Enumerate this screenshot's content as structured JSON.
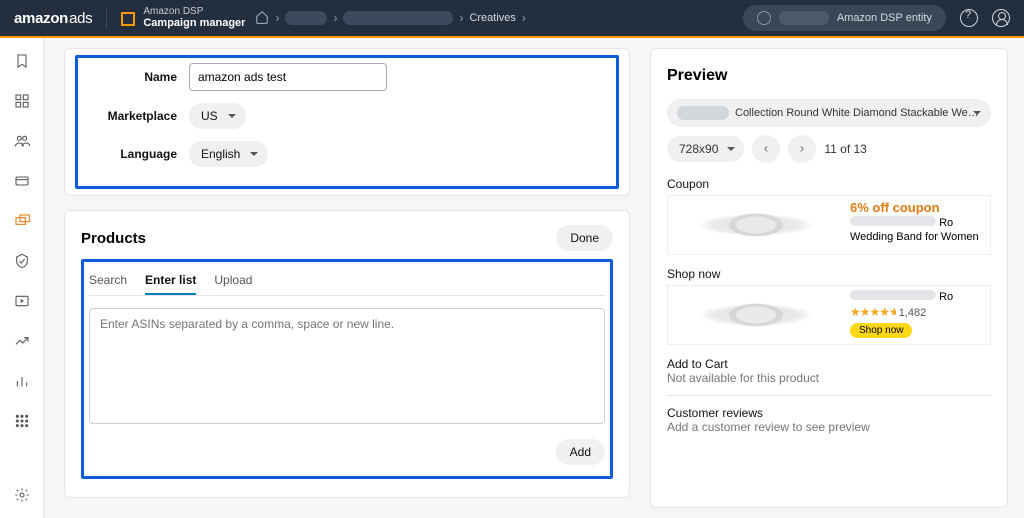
{
  "header": {
    "logo_main": "amazon",
    "logo_suffix": "ads",
    "product": "Amazon DSP",
    "app": "Campaign manager",
    "crumb_creatives": "Creatives",
    "entity_label": "Amazon DSP entity"
  },
  "form": {
    "name_label": "Name",
    "name_value": "amazon ads test",
    "marketplace_label": "Marketplace",
    "marketplace_value": "US",
    "language_label": "Language",
    "language_value": "English"
  },
  "products": {
    "heading": "Products",
    "done": "Done",
    "tabs": {
      "search": "Search",
      "enter": "Enter list",
      "upload": "Upload"
    },
    "placeholder": "Enter ASINs separated by a comma, space or new line.",
    "add": "Add"
  },
  "preview": {
    "heading": "Preview",
    "collection_text": "Collection Round White Diamond Stackable Wedding Band fo…",
    "size": "728x90",
    "pager": "11 of 13",
    "coupon_label": "Coupon",
    "coupon_headline": "6% off coupon",
    "coupon_line_suffix": "Ro",
    "coupon_line2": "Wedding Band for Women",
    "shopnow_label": "Shop now",
    "shopnow_suffix": "Ro",
    "review_count": "1,482",
    "shopnow_btn": "Shop now",
    "addtocart_label": "Add to Cart",
    "addtocart_sub": "Not available for this product",
    "reviews_label": "Customer reviews",
    "reviews_sub": "Add a customer review to see preview"
  }
}
